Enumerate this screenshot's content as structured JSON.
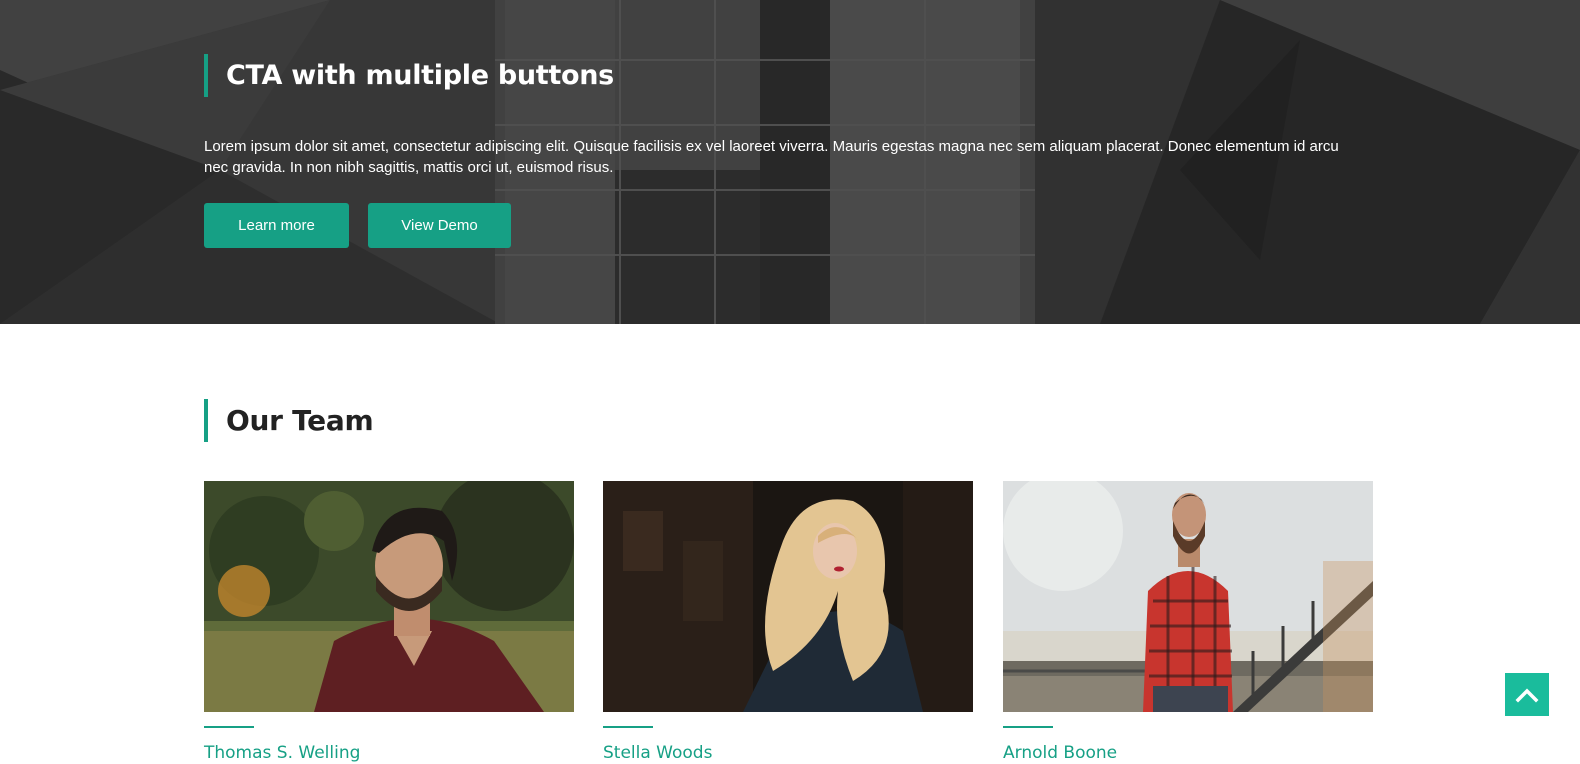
{
  "cta": {
    "heading": "CTA with multiple buttons",
    "text": "Lorem ipsum dolor sit amet, consectetur adipiscing elit. Quisque facilisis ex vel laoreet viverra. Mauris egestas magna nec sem aliquam placerat. Donec elementum id arcu nec gravida. In non nibh sagittis, mattis orci ut, euismod risus.",
    "buttons": [
      {
        "label": "Learn more"
      },
      {
        "label": "View Demo"
      }
    ]
  },
  "team": {
    "heading": "Our Team",
    "members": [
      {
        "name": "Thomas S. Welling"
      },
      {
        "name": "Stella Woods"
      },
      {
        "name": "Arnold Boone"
      }
    ]
  },
  "back_to_top": {
    "icon": "chevron-up-icon"
  },
  "colors": {
    "accent": "#16a085",
    "back_to_top": "#1abc9c",
    "hero_overlay": "#3a3a3a",
    "heading_dark": "#222222"
  }
}
